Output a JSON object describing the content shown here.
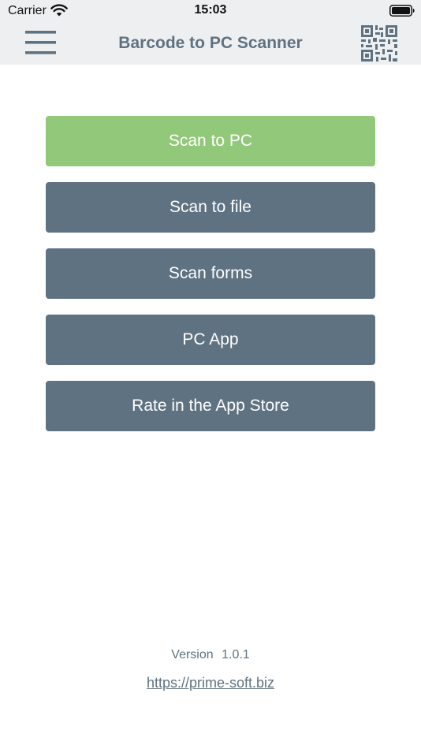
{
  "status_bar": {
    "carrier": "Carrier",
    "time": "15:03",
    "wifi_icon": "wifi-icon",
    "battery_icon": "battery-icon"
  },
  "nav": {
    "title": "Barcode to PC Scanner",
    "menu_icon": "hamburger-menu-icon",
    "qr_icon": "qr-code-icon"
  },
  "buttons": {
    "scan_to_pc": "Scan to PC",
    "scan_to_file": "Scan to file",
    "scan_forms": "Scan forms",
    "pc_app": "PC App",
    "rate": "Rate in the App Store"
  },
  "footer": {
    "version_label": "Version",
    "version_number": "1.0.1",
    "link": "https://prime-soft.biz"
  },
  "colors": {
    "accent_green": "#92c87a",
    "slate": "#5f7282",
    "bar_background": "#eeeff1",
    "background": "#ffffff"
  }
}
